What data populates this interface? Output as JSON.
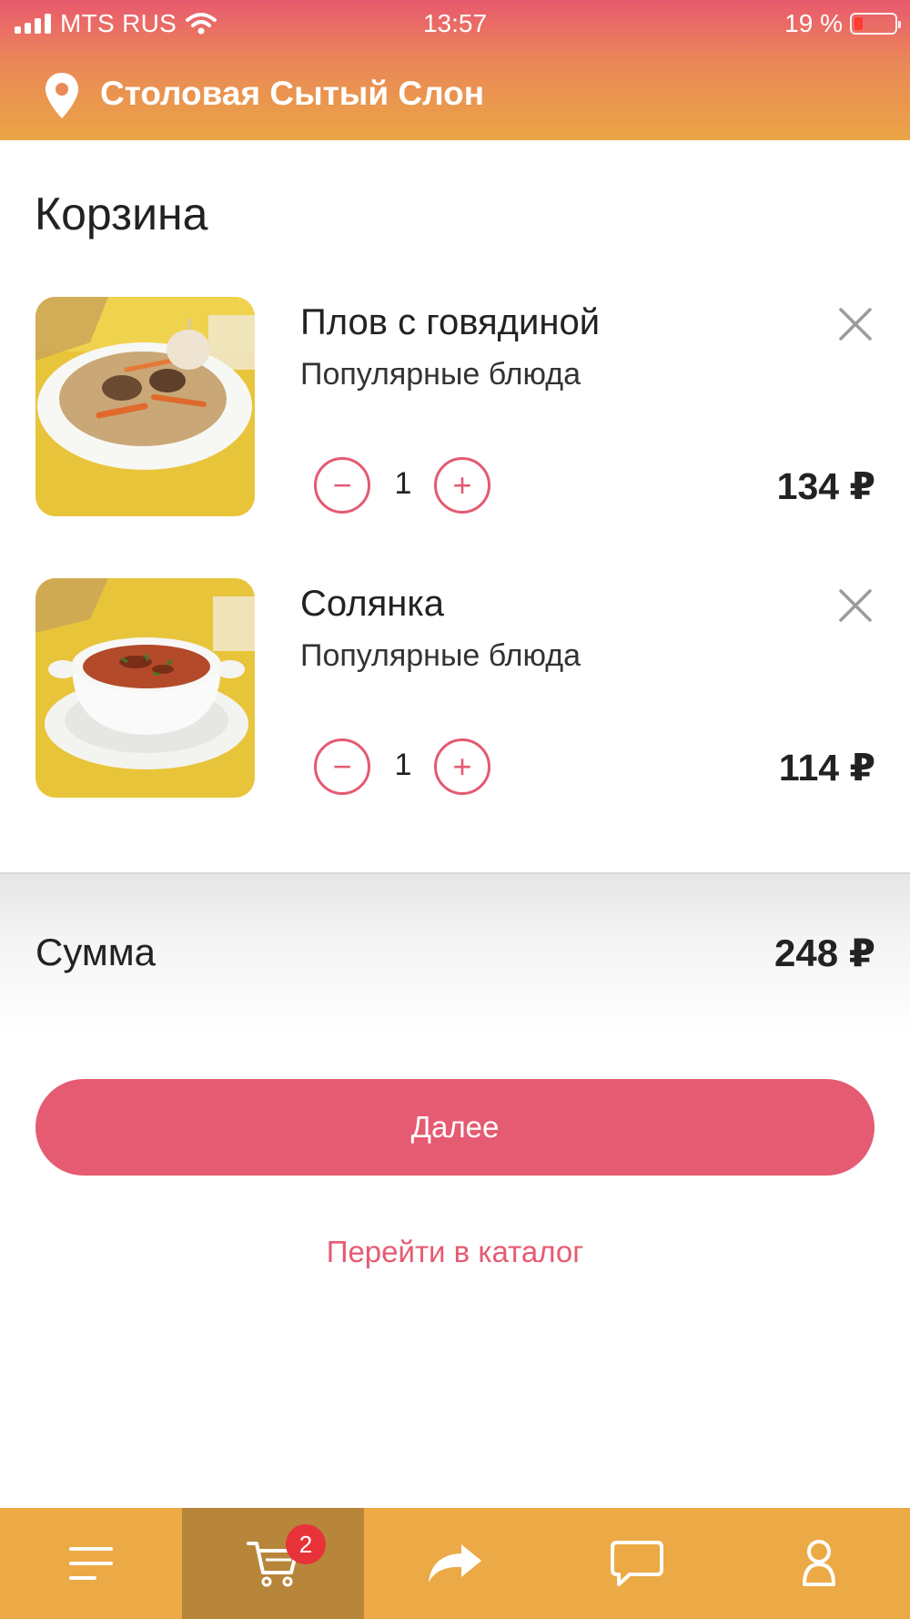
{
  "status_bar": {
    "carrier": "MTS RUS",
    "time": "13:57",
    "battery": "19 %"
  },
  "header": {
    "location": "Столовая Сытый Слон"
  },
  "page": {
    "title": "Корзина"
  },
  "cart": {
    "items": [
      {
        "name": "Плов с говядиной",
        "category": "Популярные блюда",
        "quantity": "1",
        "price": "134 ₽",
        "image_icon": "pilaf-dish-photo",
        "remove_icon": "close-icon"
      },
      {
        "name": "Солянка",
        "category": "Популярные блюда",
        "quantity": "1",
        "price": "114 ₽",
        "image_icon": "soup-bowl-photo",
        "remove_icon": "close-icon"
      }
    ],
    "minus_symbol": "−",
    "plus_symbol": "+"
  },
  "summary": {
    "label": "Сумма",
    "total": "248 ₽"
  },
  "actions": {
    "next_label": "Далее",
    "catalog_link": "Перейти в каталог"
  },
  "tabbar": {
    "tabs": [
      {
        "icon": "menu-icon",
        "active": false
      },
      {
        "icon": "cart-icon",
        "active": true,
        "badge": "2"
      },
      {
        "icon": "share-icon",
        "active": false
      },
      {
        "icon": "chat-icon",
        "active": false
      },
      {
        "icon": "profile-icon",
        "active": false
      }
    ]
  },
  "colors": {
    "accent": "#e55b72",
    "tabbar": "#ebaa45",
    "tab_active": "#b7863a",
    "badge": "#e8323a"
  }
}
